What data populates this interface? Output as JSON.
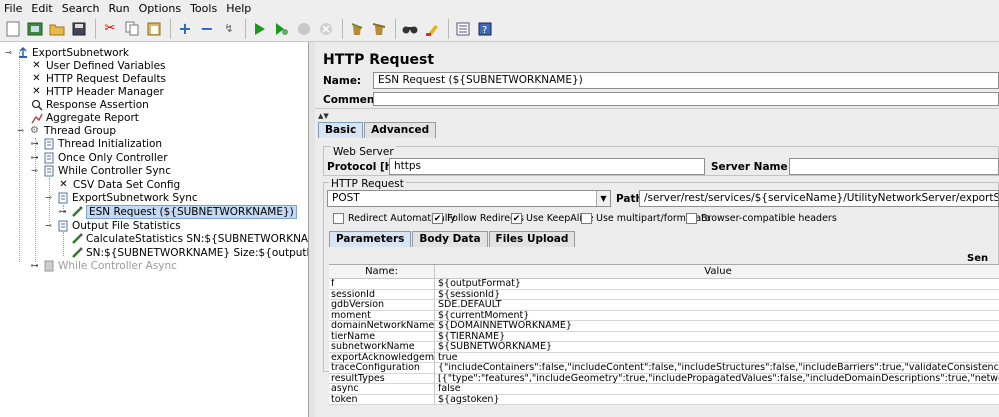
{
  "menu": [
    "File",
    "Edit",
    "Search",
    "Run",
    "Options",
    "Tools",
    "Help"
  ],
  "toolbar_icons": [
    "new-icon",
    "templates-icon",
    "open-icon",
    "save-icon",
    "cut-icon",
    "copy-icon",
    "paste-icon",
    "expand-icon",
    "collapse-icon",
    "toggle-icon",
    "start-icon",
    "start-no-pause-icon",
    "stop-icon",
    "shutdown-icon",
    "clear-icon",
    "clear-all-icon",
    "search-icon",
    "reset-search-icon",
    "function-helper-icon",
    "help-icon"
  ],
  "tree": [
    {
      "label": "ExportSubnetwork",
      "icon": "test-plan-icon"
    },
    {
      "label": "User Defined Variables",
      "icon": "wrench-icon"
    },
    {
      "label": "HTTP Request Defaults",
      "icon": "wrench-icon"
    },
    {
      "label": "HTTP Header Manager",
      "icon": "wrench-icon"
    },
    {
      "label": "Response Assertion",
      "icon": "magnifier-icon"
    },
    {
      "label": "Aggregate Report",
      "icon": "chart-icon"
    },
    {
      "label": "Thread Group",
      "icon": "gear-icon"
    },
    {
      "label": "Thread Initialization",
      "icon": "controller-icon"
    },
    {
      "label": "Once Only Controller",
      "icon": "controller-icon"
    },
    {
      "label": "While Controller Sync",
      "icon": "controller-icon"
    },
    {
      "label": "CSV Data Set Config",
      "icon": "wrench-icon"
    },
    {
      "label": "ExportSubnetwork Sync",
      "icon": "controller-icon"
    },
    {
      "label": "ESN Request (${SUBNETWORKNAME})",
      "icon": "pipette-icon"
    },
    {
      "label": "Output File Statistics",
      "icon": "controller-icon"
    },
    {
      "label": "CalculateStatistics SN:${SUBNETWORKNAME}",
      "icon": "pipette-icon"
    },
    {
      "label": "SN:${SUBNETWORKNAME} Size:${outputFileSizeKB}KB",
      "icon": "pipette-icon"
    },
    {
      "label": "While Controller Async",
      "icon": "controller-disabled-icon"
    }
  ],
  "panel": {
    "title": "HTTP Request",
    "name_label": "Name:",
    "name_value": "ESN Request (${SUBNETWORKNAME})",
    "comments_label": "Comments:",
    "comments_value": "",
    "tabs": [
      "Basic",
      "Advanced"
    ],
    "web_server": {
      "legend": "Web Server",
      "protocol_label": "Protocol [http]:",
      "protocol_value": "https",
      "server_label": "Server Name or IP:",
      "server_value": ""
    },
    "http_request": {
      "legend": "HTTP Request",
      "method": "POST",
      "path_label": "Path:",
      "path_value": "/server/rest/services/${serviceName}/UtilityNetworkServer/exportSubnetwork"
    },
    "checkboxes": [
      {
        "label": "Redirect Automatically",
        "checked": false
      },
      {
        "label": "Follow Redirects",
        "checked": true
      },
      {
        "label": "Use KeepAlive",
        "checked": true
      },
      {
        "label": "Use multipart/form-data",
        "checked": false
      },
      {
        "label": "Browser-compatible headers",
        "checked": false
      }
    ],
    "subtabs": [
      "Parameters",
      "Body Data",
      "Files Upload"
    ],
    "send_header": "Sen",
    "params_header": {
      "name": "Name:",
      "value": "Value"
    },
    "params": [
      {
        "name": "f",
        "value": "${outputFormat}"
      },
      {
        "name": "sessionId",
        "value": "${sessionId}"
      },
      {
        "name": "gdbVersion",
        "value": "SDE.DEFAULT"
      },
      {
        "name": "moment",
        "value": "${currentMoment}"
      },
      {
        "name": "domainNetworkName",
        "value": "${DOMAINNETWORKNAME}"
      },
      {
        "name": "tierName",
        "value": "${TIERNAME}"
      },
      {
        "name": "subnetworkName",
        "value": "${SUBNETWORKNAME}"
      },
      {
        "name": "exportAcknowledgement",
        "value": "true"
      },
      {
        "name": "traceConfiguration",
        "value": "{\"includeContainers\":false,\"includeContent\":false,\"includeStructures\":false,\"includeBarriers\":true,\"validateConsistency\":true,\"validateLocatability\":f..."
      },
      {
        "name": "resultTypes",
        "value": "[{\"type\":\"features\",\"includeGeometry\":true,\"includePropagatedValues\":false,\"includeDomainDescriptions\":true,\"networkAttributeNames\":[\"Source I..."
      },
      {
        "name": "async",
        "value": "false"
      },
      {
        "name": "token",
        "value": "${agstoken}"
      }
    ]
  }
}
